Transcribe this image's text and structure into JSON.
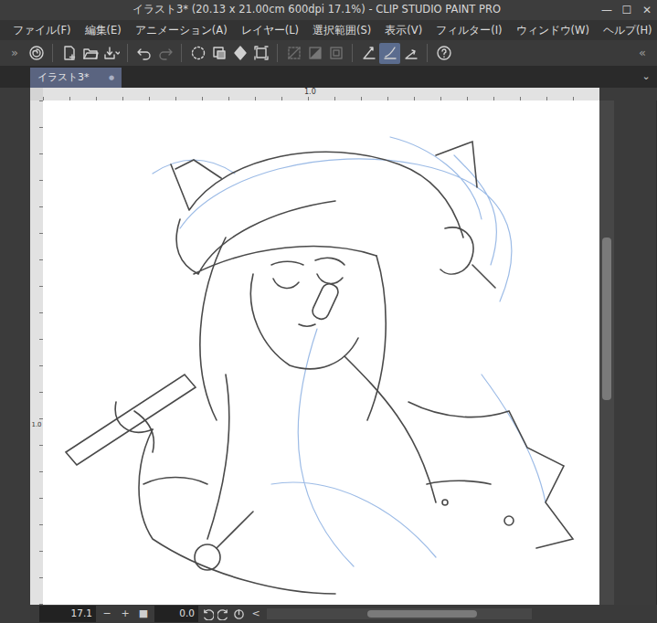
{
  "window": {
    "title": "イラスト3* (20.13 x 21.00cm 600dpi 17.1%) - CLIP STUDIO PAINT PRO",
    "controls": [
      "—",
      "☐",
      "✕"
    ]
  },
  "menu": [
    "ファイル(F)",
    "編集(E)",
    "アニメーション(A)",
    "レイヤー(L)",
    "選択範囲(S)",
    "表示(V)",
    "フィルター(I)",
    "ウィンドウ(W)",
    "ヘルプ(H)"
  ],
  "toolbar": {
    "expand_left": "»",
    "expand_right": "«",
    "tools": [
      {
        "selected": false,
        "disabled": false
      },
      {
        "selected": false,
        "disabled": false
      },
      {
        "selected": false,
        "disabled": false
      },
      {
        "selected": false,
        "disabled": false
      },
      {
        "selected": false,
        "disabled": false
      },
      {
        "selected": false,
        "disabled": true
      },
      {
        "selected": false,
        "disabled": false
      },
      {
        "selected": false,
        "disabled": false
      },
      {
        "selected": false,
        "disabled": false
      },
      {
        "selected": false,
        "disabled": false
      },
      {
        "selected": false,
        "disabled": true
      },
      {
        "selected": false,
        "disabled": true
      },
      {
        "selected": false,
        "disabled": true
      },
      {
        "selected": false,
        "disabled": false
      },
      {
        "selected": true,
        "disabled": false
      },
      {
        "selected": false,
        "disabled": false
      },
      {
        "selected": false,
        "disabled": false
      }
    ]
  },
  "tabs": [
    {
      "label": "イラスト3*",
      "selected": true,
      "modified_mark": "●"
    }
  ],
  "tab_menu": "⌄",
  "rulers": {
    "top": "1.0",
    "left": "1.0"
  },
  "status_bar": {
    "zoom": "17.1",
    "zoom_out": "−",
    "zoom_in": "+",
    "fit": "■",
    "rotation": "0.0",
    "scroll_left": "<"
  }
}
